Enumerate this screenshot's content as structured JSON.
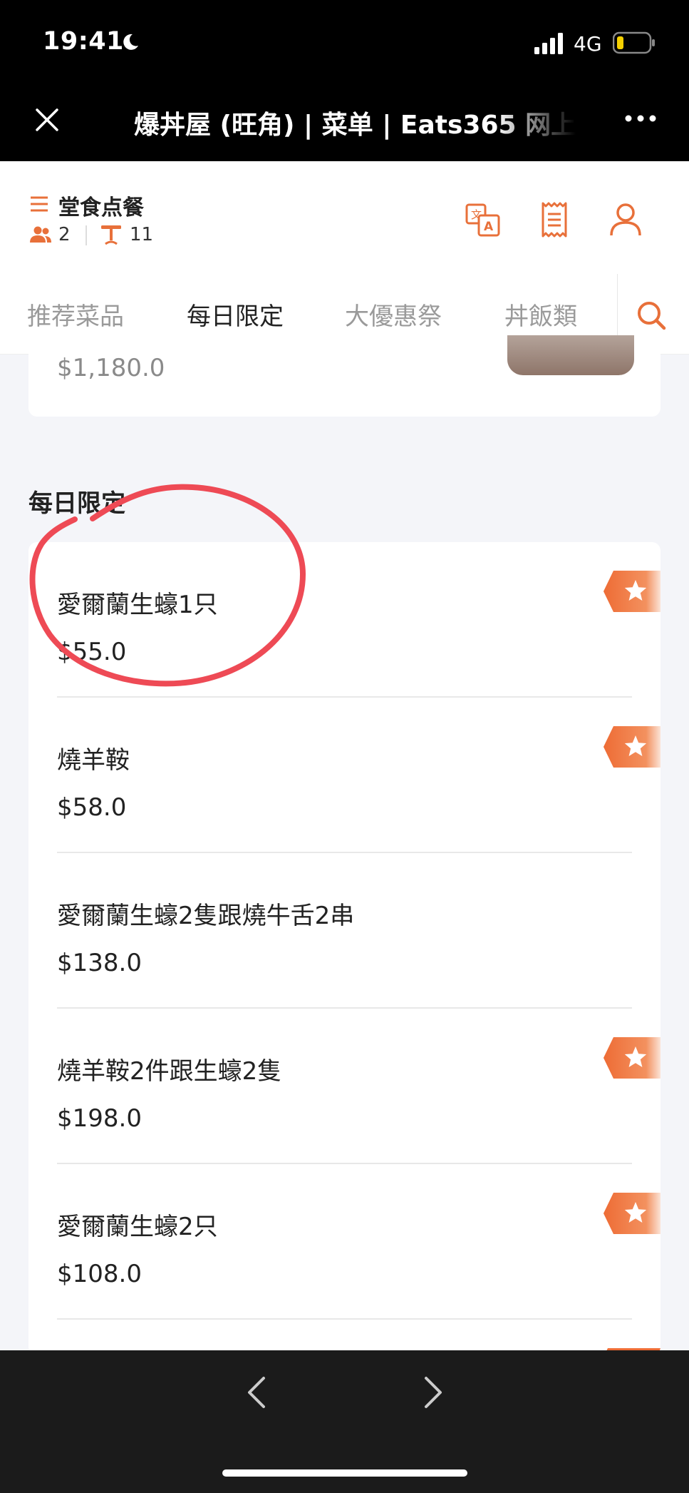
{
  "status": {
    "time": "19:41",
    "network": "4G"
  },
  "browser": {
    "title": "爆丼屋 (旺角) | 菜单 | Eats365 网上"
  },
  "order": {
    "mode": "堂食点餐",
    "people": "2",
    "table": "11"
  },
  "tabs": [
    {
      "label": "推荐菜品"
    },
    {
      "label": "每日限定"
    },
    {
      "label": "大優惠祭"
    },
    {
      "label": "丼飯類"
    }
  ],
  "active_tab": "每日限定",
  "previous_item": {
    "price": "$1,180.0"
  },
  "section": {
    "title": "每日限定"
  },
  "items": [
    {
      "name": "愛爾蘭生蠔1只",
      "price": "$55.0",
      "featured": true
    },
    {
      "name": "燒羊鞍",
      "price": "$58.0",
      "featured": true
    },
    {
      "name": "愛爾蘭生蠔2隻跟燒牛舌2串",
      "price": "$138.0",
      "featured": false
    },
    {
      "name": "燒羊鞍2件跟生蠔2隻",
      "price": "$198.0",
      "featured": true
    },
    {
      "name": "愛爾蘭生蠔2只",
      "price": "$108.0",
      "featured": true
    }
  ],
  "colors": {
    "accent": "#e8703a",
    "annotation": "#ee4a55"
  },
  "icons": [
    "moon-icon",
    "signal-icon",
    "battery-icon",
    "close-icon",
    "more-icon",
    "menu-icon",
    "people-icon",
    "table-icon",
    "translate-icon",
    "receipt-icon",
    "user-icon",
    "search-icon",
    "star-icon",
    "back-icon",
    "forward-icon"
  ]
}
